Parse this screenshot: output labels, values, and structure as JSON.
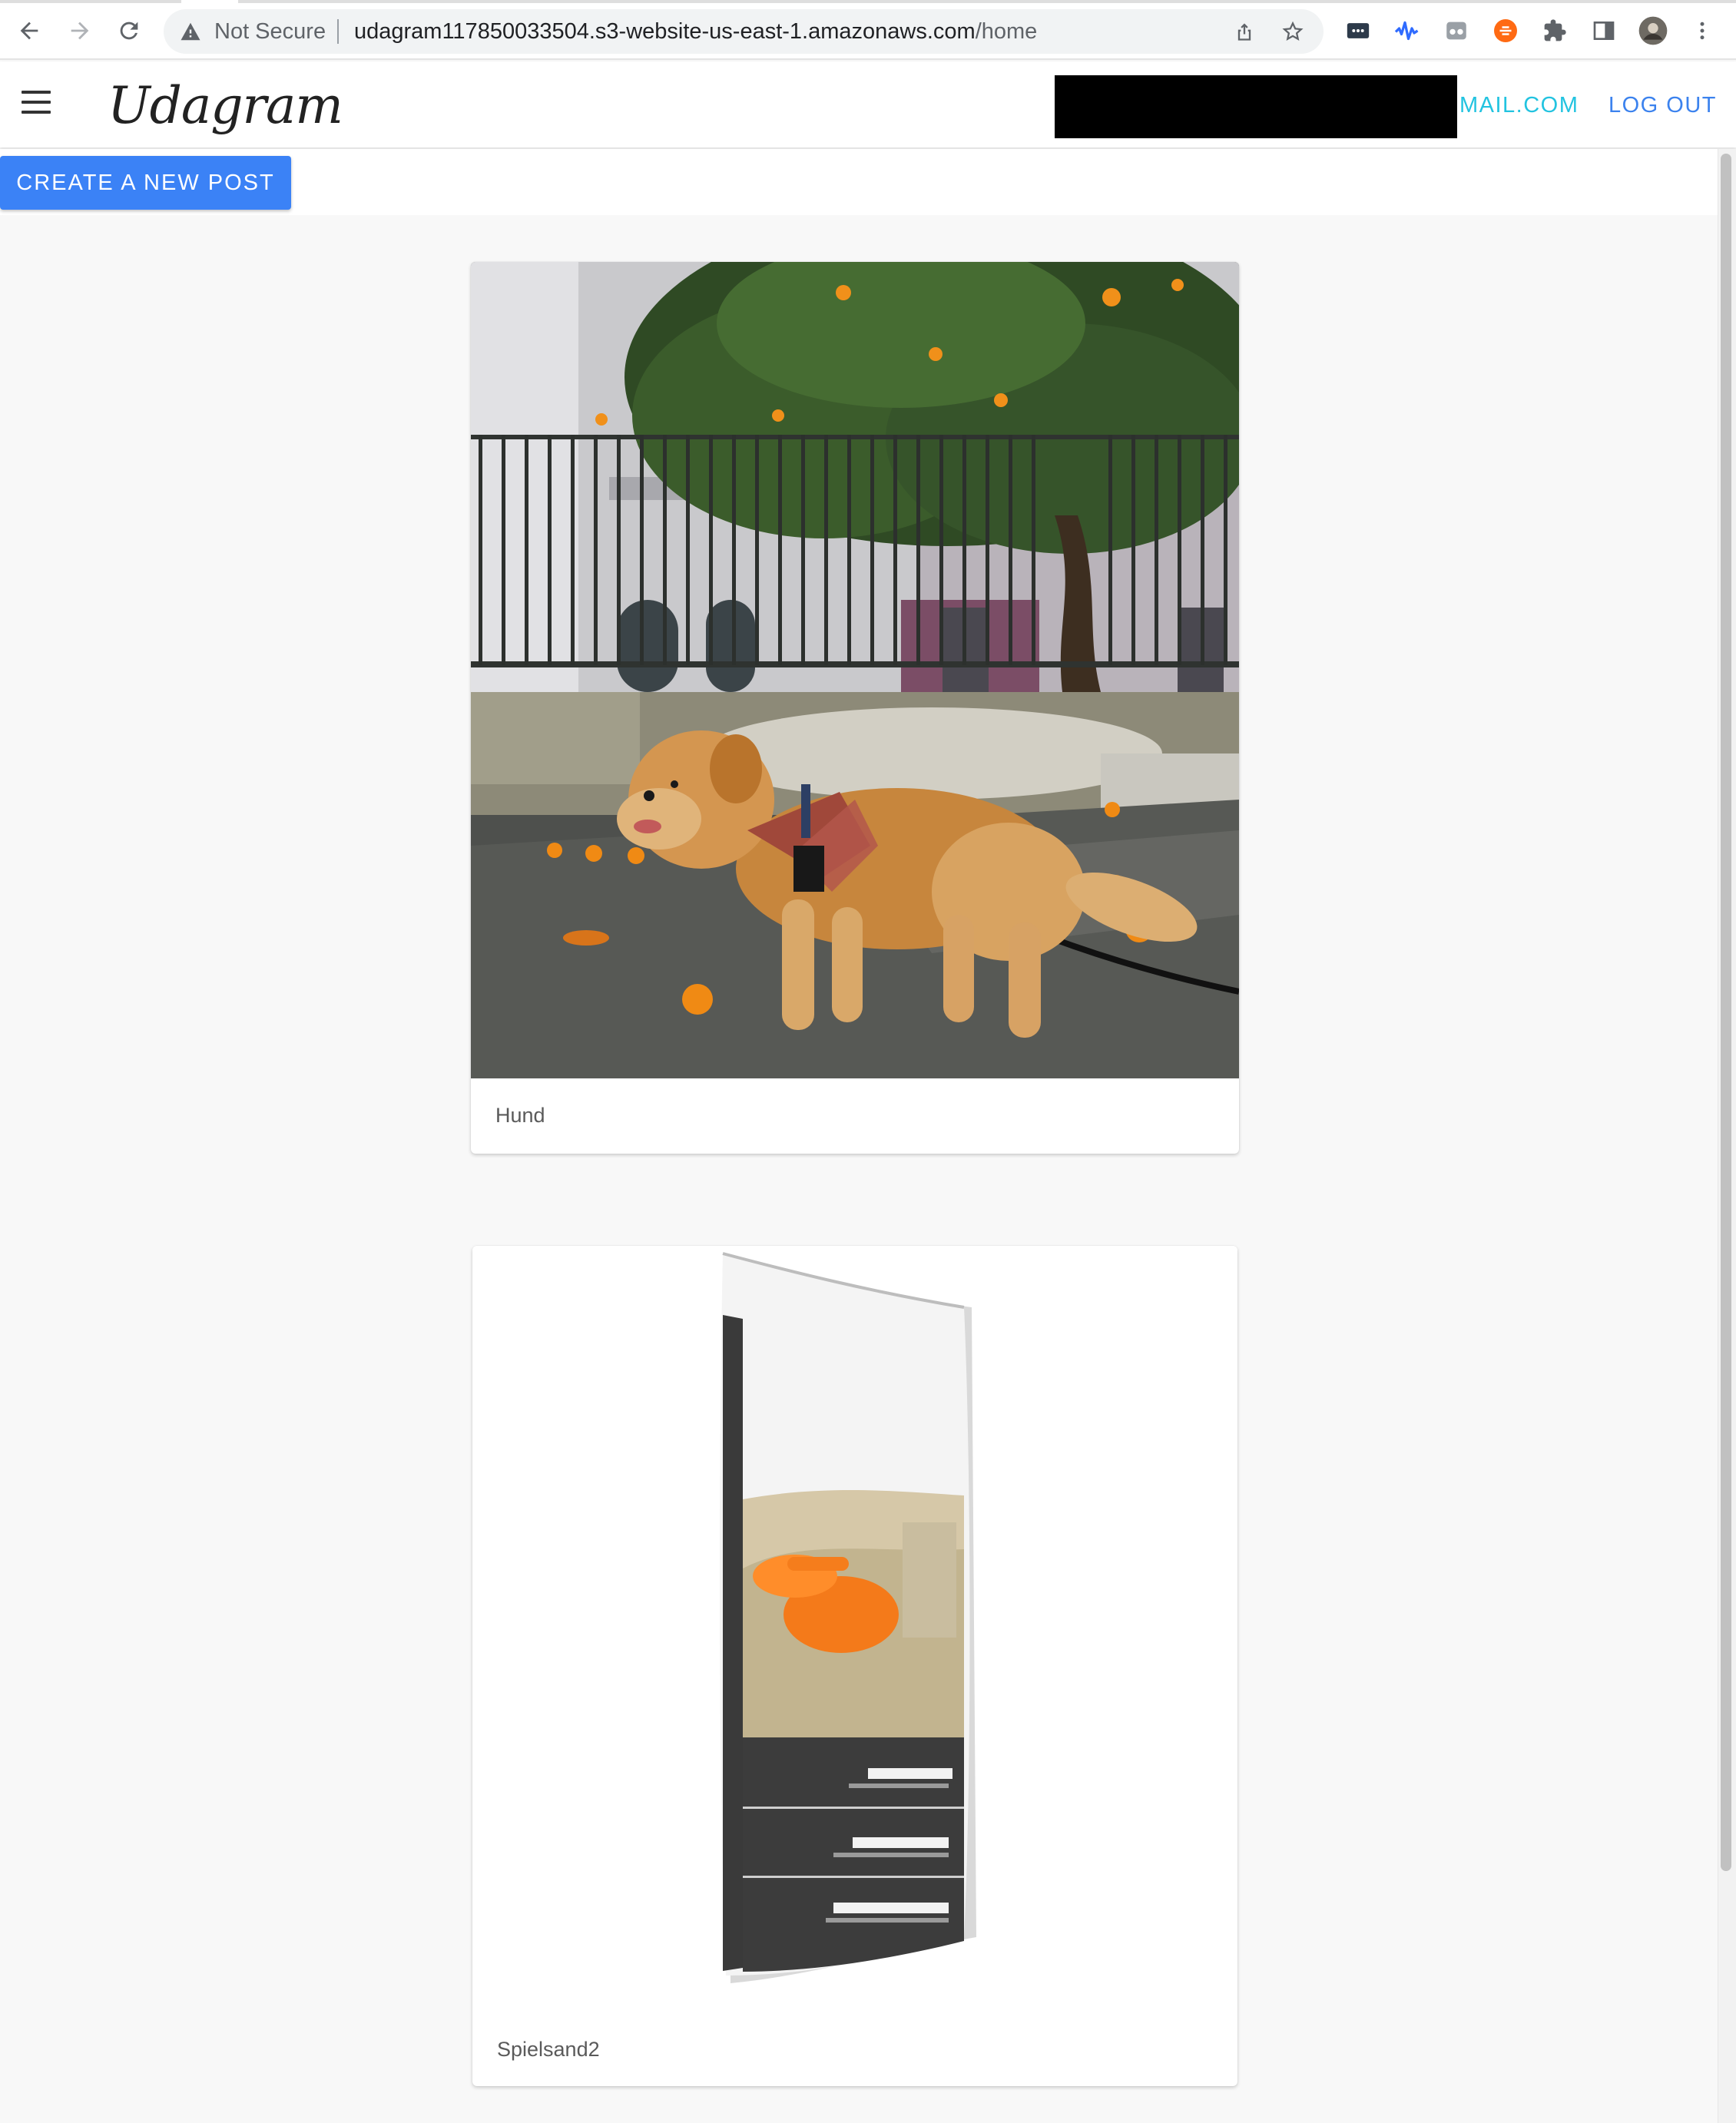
{
  "browser": {
    "security_label": "Not Secure",
    "url_host": "udagram117850033504.s3-website-us-east-1.amazonaws.com",
    "url_path": "/home"
  },
  "app": {
    "brand": "Udagram",
    "nav": {
      "email_suffix": "MAIL.COM",
      "logout": "LOG OUT"
    },
    "create_button": "CREATE A NEW POST",
    "accent_colors": {
      "primary": "#3b82f6",
      "email": "#22c3e0"
    }
  },
  "feed": {
    "posts": [
      {
        "caption": "Hund"
      },
      {
        "caption": "Spielsand2"
      }
    ]
  }
}
